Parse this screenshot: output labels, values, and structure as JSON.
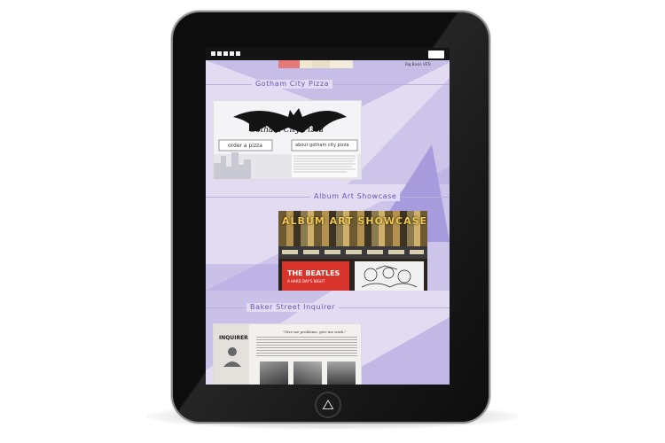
{
  "device": {
    "status_bar": {
      "signal_icon": "signal-bars-icon",
      "battery_icon": "battery-icon"
    },
    "home_button_icon": "triangle-icon"
  },
  "colors": {
    "screen_bg": "#e2dbf1",
    "accent": "#6a55b8",
    "triangles": "#a79bdc"
  },
  "top_strip": {
    "partial_text": "Big Basin VETs"
  },
  "portfolio": [
    {
      "title": "Gotham City Pizza",
      "logo_text": "Gotham City Pizza",
      "buttons": [
        "order a pizza",
        "about gotham city pizza"
      ]
    },
    {
      "title": "Album Art Showcase",
      "banner_text": "ALBUM ART SHOWCASE",
      "album_text": "THE BEATLES",
      "album_subtext": "A HARD DAY'S NIGHT"
    },
    {
      "title": "Baker Street Inquirer",
      "masthead": "INQUIRER",
      "quote": "\"Give me problems, give me work.\""
    }
  ]
}
